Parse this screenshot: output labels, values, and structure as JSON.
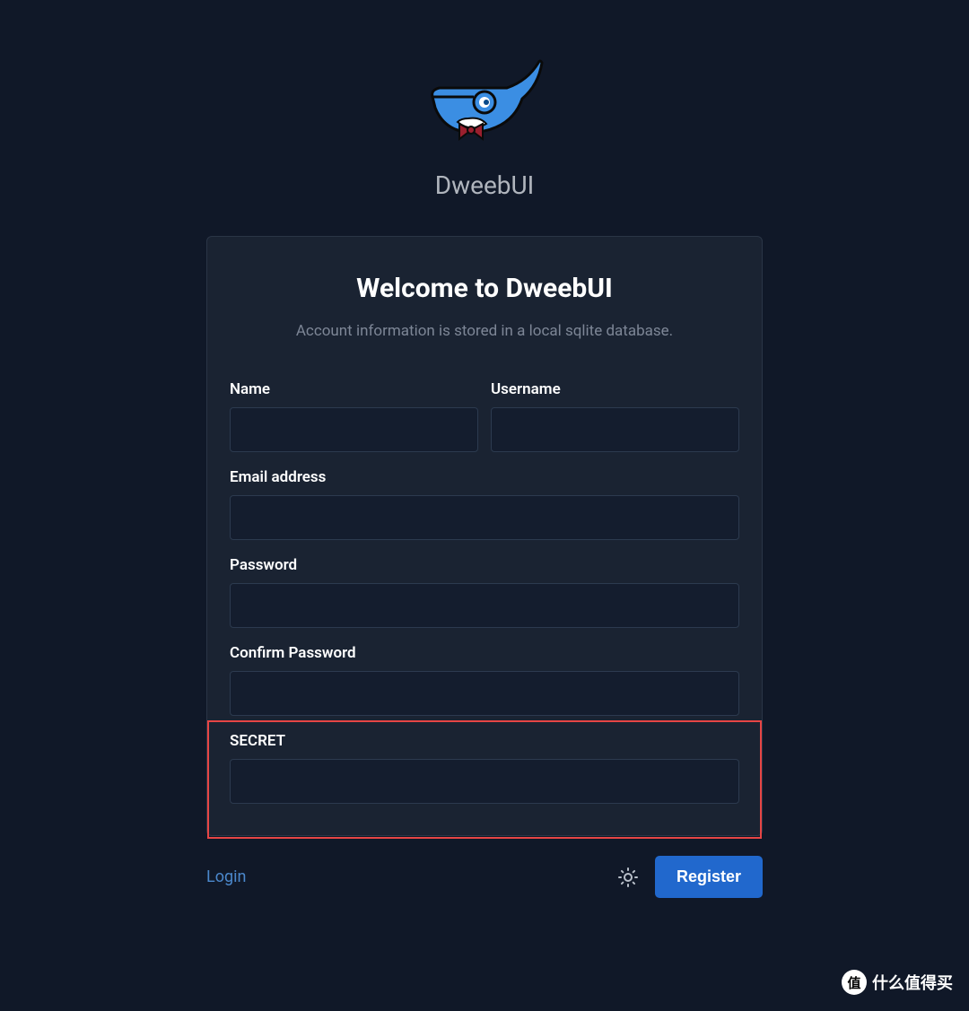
{
  "app": {
    "title": "DweebUI"
  },
  "card": {
    "heading": "Welcome to DweebUI",
    "subtitle": "Account information is stored in a local sqlite database."
  },
  "form": {
    "name": {
      "label": "Name",
      "value": ""
    },
    "username": {
      "label": "Username",
      "value": ""
    },
    "email": {
      "label": "Email address",
      "value": ""
    },
    "password": {
      "label": "Password",
      "value": ""
    },
    "confirm_password": {
      "label": "Confirm Password",
      "value": ""
    },
    "secret": {
      "label": "SECRET",
      "value": ""
    }
  },
  "footer": {
    "login_link": "Login",
    "register_button": "Register"
  },
  "watermark": {
    "badge": "值",
    "text": "什么值得买"
  }
}
